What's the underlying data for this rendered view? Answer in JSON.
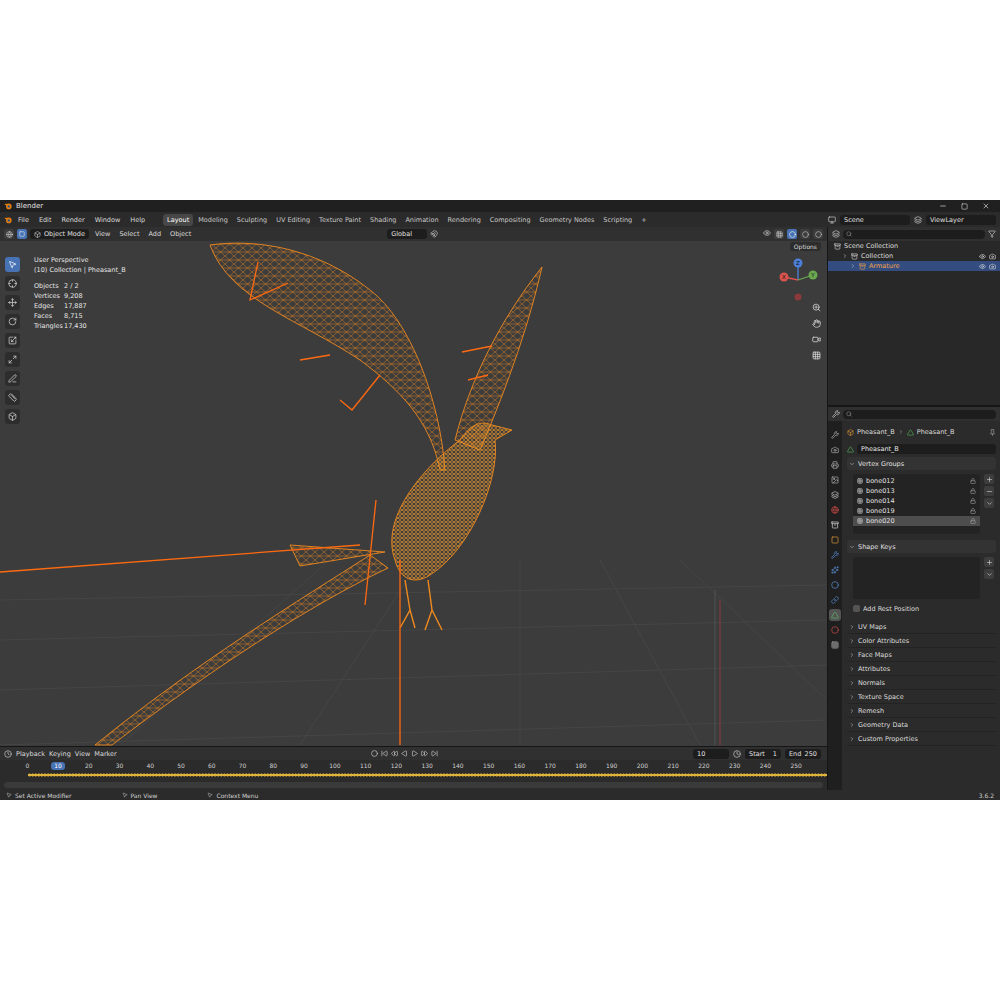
{
  "window": {
    "title": "Blender",
    "version": "3.6.2"
  },
  "menu": [
    "File",
    "Edit",
    "Render",
    "Window",
    "Help"
  ],
  "workspaces": [
    {
      "label": "Layout",
      "selected": true
    },
    {
      "label": "Modeling",
      "selected": false
    },
    {
      "label": "Sculpting",
      "selected": false
    },
    {
      "label": "UV Editing",
      "selected": false
    },
    {
      "label": "Texture Paint",
      "selected": false
    },
    {
      "label": "Shading",
      "selected": false
    },
    {
      "label": "Animation",
      "selected": false
    },
    {
      "label": "Rendering",
      "selected": false
    },
    {
      "label": "Compositing",
      "selected": false
    },
    {
      "label": "Geometry Nodes",
      "selected": false
    },
    {
      "label": "Scripting",
      "selected": false
    }
  ],
  "add_workspace": "+",
  "scene": "Scene",
  "view_layer": "ViewLayer",
  "viewport": {
    "mode": "Object Mode",
    "menu": [
      "View",
      "Select",
      "Add",
      "Object"
    ],
    "orientation": "Global",
    "options": "Options",
    "perspective": "User Perspective",
    "context": "(10) Collection | Pheasant_B",
    "stats": [
      {
        "label": "Objects",
        "value": "2 / 2"
      },
      {
        "label": "Vertices",
        "value": "9,208"
      },
      {
        "label": "Edges",
        "value": "17,887"
      },
      {
        "label": "Faces",
        "value": "8,715"
      },
      {
        "label": "Triangles",
        "value": "17,430"
      }
    ],
    "axes": [
      "X",
      "Y",
      "Z"
    ]
  },
  "tools": [
    {
      "selected": true
    },
    {
      "selected": false
    },
    {
      "selected": false
    },
    {
      "selected": false
    },
    {
      "selected": false
    },
    {
      "selected": false
    },
    {
      "selected": false
    },
    {
      "selected": false
    },
    {
      "selected": false
    }
  ],
  "outliner": {
    "items": [
      {
        "label": "Scene Collection",
        "depth": 0,
        "selected": false
      },
      {
        "label": "Collection",
        "depth": 1,
        "selected": false
      },
      {
        "label": "Armature",
        "depth": 2,
        "selected": true
      }
    ]
  },
  "properties": {
    "breadcrumb": [
      "Pheasant_B",
      "Pheasant_B"
    ],
    "data_name": "Pheasant_B",
    "tabs": [
      {
        "selected": false
      },
      {
        "selected": false
      },
      {
        "selected": false
      },
      {
        "selected": false
      },
      {
        "selected": false
      },
      {
        "selected": false
      },
      {
        "selected": false
      },
      {
        "selected": false
      },
      {
        "selected": false
      },
      {
        "selected": false
      },
      {
        "selected": false
      },
      {
        "selected": false
      },
      {
        "selected": true
      },
      {
        "selected": false
      },
      {
        "selected": false
      }
    ],
    "vertex_groups": {
      "title": "Vertex Groups",
      "expanded": true,
      "items": [
        {
          "label": "bone012",
          "selected": false
        },
        {
          "label": "bone013",
          "selected": false
        },
        {
          "label": "bone014",
          "selected": false
        },
        {
          "label": "bone019",
          "selected": false
        },
        {
          "label": "bone020",
          "selected": true
        }
      ]
    },
    "shape_keys": {
      "title": "Shape Keys",
      "expanded": true
    },
    "rest_position": {
      "label": "Add Rest Position",
      "checked": false
    },
    "sections": [
      {
        "title": "UV Maps",
        "expanded": false
      },
      {
        "title": "Color Attributes",
        "expanded": false
      },
      {
        "title": "Face Maps",
        "expanded": false
      },
      {
        "title": "Attributes",
        "expanded": false
      },
      {
        "title": "Normals",
        "expanded": false
      },
      {
        "title": "Texture Space",
        "expanded": false
      },
      {
        "title": "Remesh",
        "expanded": false
      },
      {
        "title": "Geometry Data",
        "expanded": false
      },
      {
        "title": "Custom Properties",
        "expanded": false
      }
    ]
  },
  "timeline": {
    "menu": [
      "Playback",
      "Keying",
      "View",
      "Marker"
    ],
    "frame": "10",
    "start_label": "Start",
    "start": "1",
    "end_label": "End",
    "end": "250",
    "ticks": [
      {
        "label": "0",
        "selected": false
      },
      {
        "label": "10",
        "selected": true
      },
      {
        "label": "20",
        "selected": false
      },
      {
        "label": "30",
        "selected": false
      },
      {
        "label": "40",
        "selected": false
      },
      {
        "label": "50",
        "selected": false
      },
      {
        "label": "60",
        "selected": false
      },
      {
        "label": "70",
        "selected": false
      },
      {
        "label": "80",
        "selected": false
      },
      {
        "label": "90",
        "selected": false
      },
      {
        "label": "100",
        "selected": false
      },
      {
        "label": "110",
        "selected": false
      },
      {
        "label": "120",
        "selected": false
      },
      {
        "label": "130",
        "selected": false
      },
      {
        "label": "140",
        "selected": false
      },
      {
        "label": "150",
        "selected": false
      },
      {
        "label": "160",
        "selected": false
      },
      {
        "label": "170",
        "selected": false
      },
      {
        "label": "180",
        "selected": false
      },
      {
        "label": "190",
        "selected": false
      },
      {
        "label": "200",
        "selected": false
      },
      {
        "label": "210",
        "selected": false
      },
      {
        "label": "220",
        "selected": false
      },
      {
        "label": "230",
        "selected": false
      },
      {
        "label": "240",
        "selected": false
      },
      {
        "label": "250",
        "selected": false
      }
    ]
  },
  "status": [
    "Set Active Modifier",
    "Pan View",
    "Context Menu"
  ]
}
